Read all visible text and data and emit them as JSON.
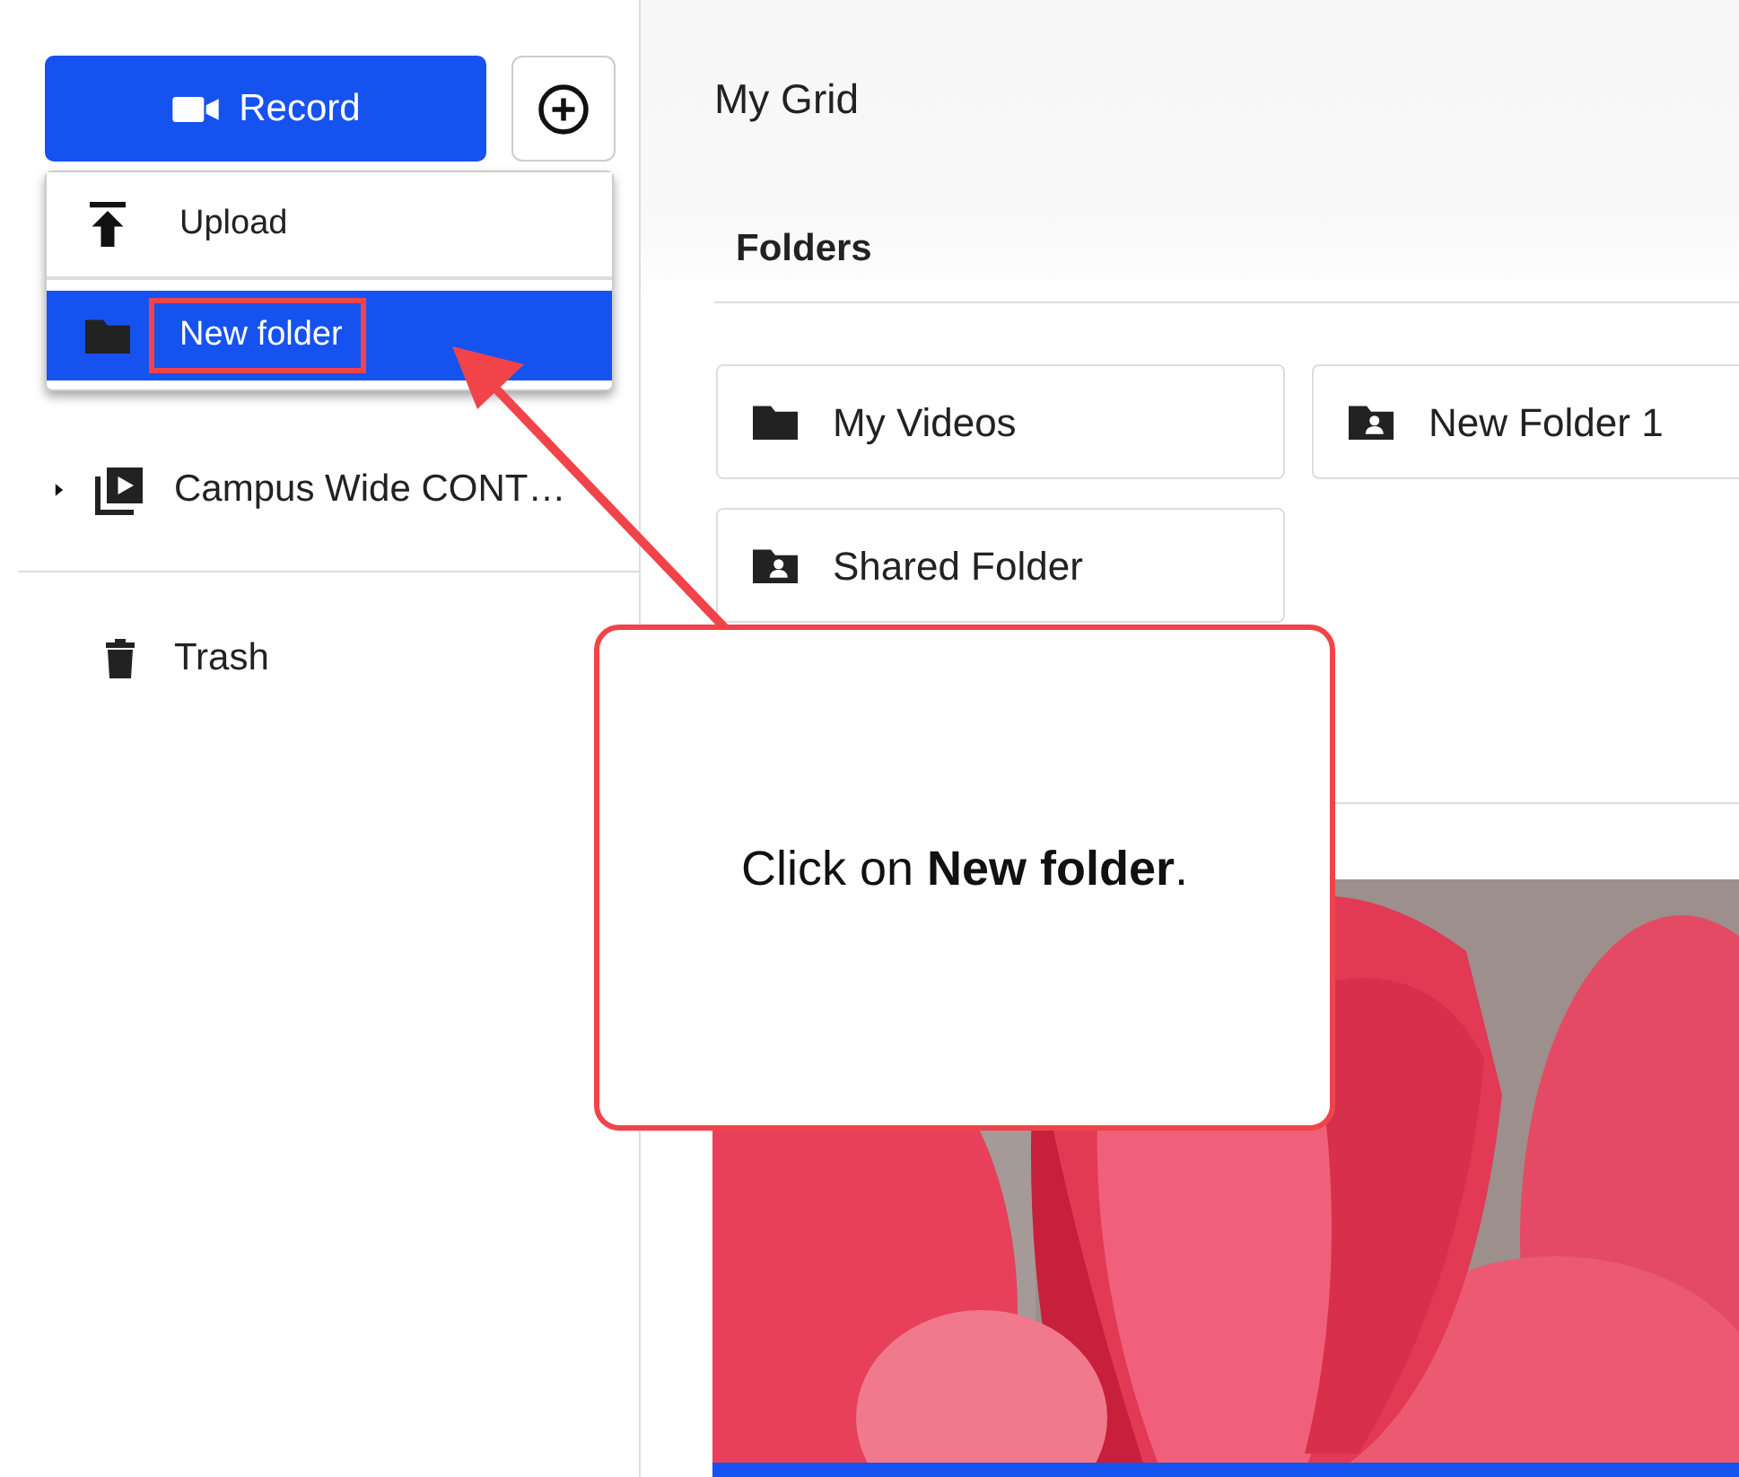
{
  "sidebar": {
    "record_button": {
      "label": "Record"
    },
    "menu": [
      {
        "label": "Upload",
        "kind": "upload",
        "selected": false,
        "highlighted": false
      },
      {
        "label": "New folder",
        "kind": "folder",
        "selected": true,
        "highlighted": true
      }
    ],
    "tree": [
      {
        "label": "Campus Wide CONT…",
        "kind": "channel",
        "expanded": false
      }
    ],
    "trash": {
      "label": "Trash"
    }
  },
  "main": {
    "title": "My Grid",
    "folders_heading": "Folders",
    "folders": [
      {
        "label": "My Videos",
        "kind": "personal"
      },
      {
        "label": "New Folder 1",
        "kind": "shared"
      },
      {
        "label": "Shared Folder",
        "kind": "shared"
      }
    ]
  },
  "callout": {
    "text": "Click on **New folder**."
  }
}
